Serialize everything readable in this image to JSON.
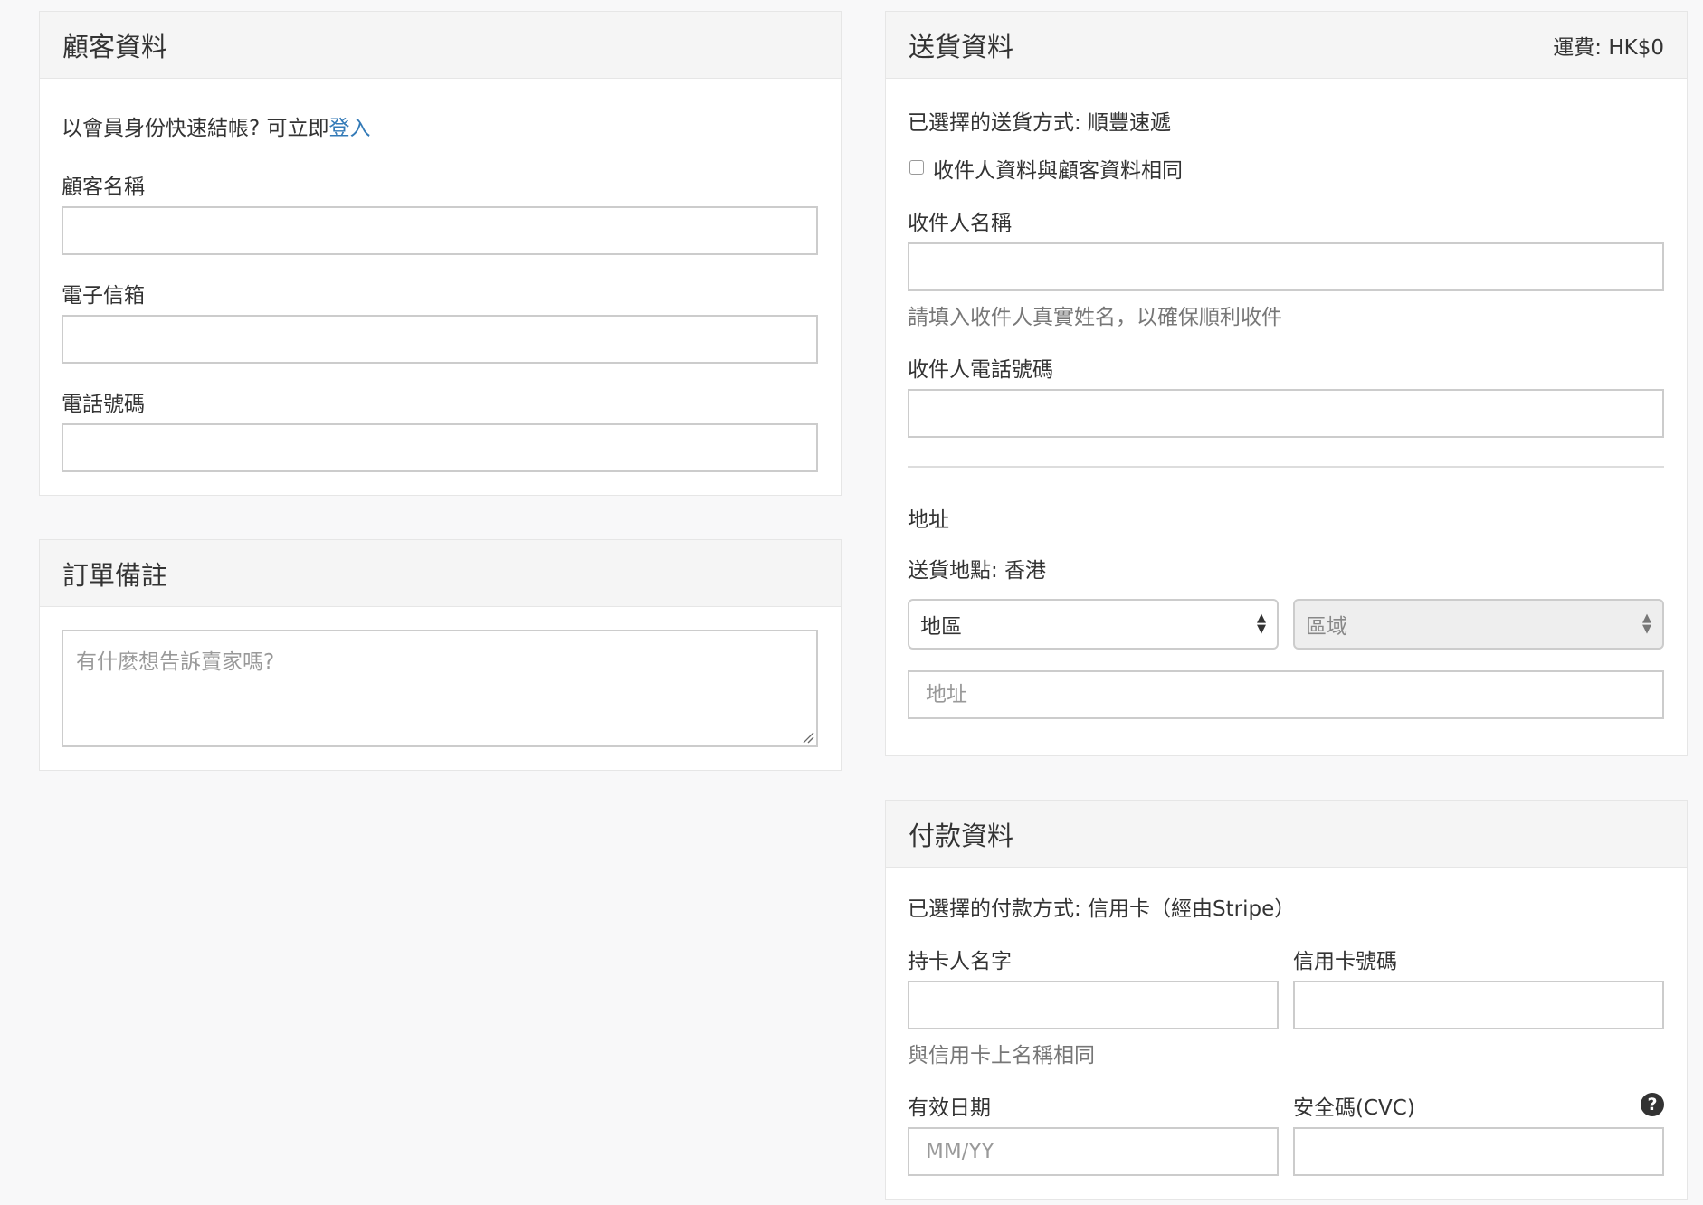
{
  "customer": {
    "title": "顧客資料",
    "login_prompt": "以會員身份快速結帳? 可立即",
    "login_link": "登入",
    "name_label": "顧客名稱",
    "email_label": "電子信箱",
    "phone_label": "電話號碼"
  },
  "order_note": {
    "title": "訂單備註",
    "placeholder": "有什麼想告訴賣家嗎?"
  },
  "delivery": {
    "title": "送貨資料",
    "shipping_fee": "運費: HK$0",
    "method_text": "已選擇的送貨方式: 順豐速遞",
    "same_as_customer_label": "收件人資料與顧客資料相同",
    "recipient_name_label": "收件人名稱",
    "recipient_name_help": "請填入收件人真實姓名，以確保順利收件",
    "recipient_phone_label": "收件人電話號碼",
    "address_heading": "地址",
    "location_text": "送貨地點: 香港",
    "region_select": "地區",
    "district_select": "區域",
    "address_placeholder": "地址"
  },
  "payment": {
    "title": "付款資料",
    "method_text": "已選擇的付款方式: 信用卡（經由Stripe）",
    "cardholder_label": "持卡人名字",
    "card_number_label": "信用卡號碼",
    "cardholder_help": "與信用卡上名稱相同",
    "expiry_label": "有效日期",
    "expiry_placeholder": "MM/YY",
    "cvc_label": "安全碼(CVC)",
    "cvc_help_icon": "question-circle-icon"
  }
}
